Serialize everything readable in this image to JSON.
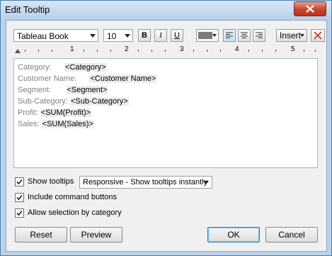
{
  "window": {
    "title": "Edit Tooltip"
  },
  "toolbar": {
    "font": "Tableau Book",
    "size": "10",
    "bold": "B",
    "italic": "I",
    "underline": "U",
    "insert": "Insert",
    "text_color": "#7a7a7a"
  },
  "ruler": {
    "numbers": [
      "1",
      "2",
      "3",
      "4",
      "5"
    ]
  },
  "editor": {
    "lines": [
      {
        "label": "Category:",
        "field": "<Category>"
      },
      {
        "label": "Customer Name:",
        "field": "<Customer Name>"
      },
      {
        "label": "Segment:",
        "field": "<Segment>"
      },
      {
        "label": "Sub-Category:",
        "field": "<Sub-Category>"
      },
      {
        "label": "Profit:",
        "field": "<SUM(Profit)>"
      },
      {
        "label": "Sales:",
        "field": "<SUM(Sales)>"
      }
    ]
  },
  "options": {
    "show_tooltips": {
      "label": "Show tooltips",
      "checked": true
    },
    "tooltip_mode": "Responsive - Show tooltips instantly",
    "include_command_buttons": {
      "label": "Include command buttons",
      "checked": true
    },
    "allow_selection": {
      "label": "Allow selection by category",
      "checked": true
    }
  },
  "buttons": {
    "reset": "Reset",
    "preview": "Preview",
    "ok": "OK",
    "cancel": "Cancel"
  }
}
